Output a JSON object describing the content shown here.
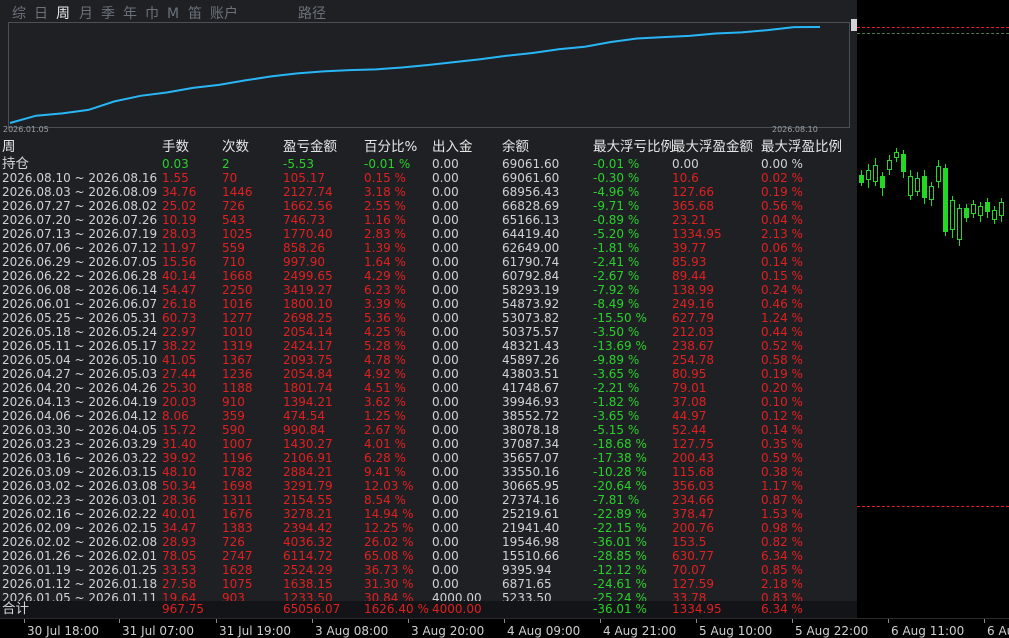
{
  "tabs": [
    {
      "label": "综",
      "active": false
    },
    {
      "label": "日",
      "active": false
    },
    {
      "label": "周",
      "active": true
    },
    {
      "label": "月",
      "active": false
    },
    {
      "label": "季",
      "active": false
    },
    {
      "label": "年",
      "active": false
    },
    {
      "label": "巾",
      "active": false
    },
    {
      "label": "M",
      "active": false
    },
    {
      "label": "笛",
      "active": false
    },
    {
      "label": "账户",
      "active": false
    },
    {
      "label": "路径",
      "active": false
    }
  ],
  "equity_curve": {
    "start_date": "2026.01.05",
    "end_date": "2026.08.10",
    "line_color": "#29b6f6"
  },
  "table": {
    "headers": [
      "周",
      "手数",
      "次数",
      "盈亏金额",
      "百分比%",
      "出入金",
      "余额",
      "最大浮亏比例",
      "最大浮盈金额",
      "最大浮盈比例"
    ],
    "holding": {
      "label": "持仓",
      "lots": "0.03",
      "count": "2",
      "pnl": "-5.53",
      "pct": "-0.01 %",
      "flow": "0.00",
      "balance": "69061.60",
      "max_dd_pct": "-0.01 %",
      "max_fp_amt": "0.00",
      "max_fp_pct": "0.00 %"
    },
    "rows": [
      [
        "2026.08.10 ~ 2026.08.16",
        "1.55",
        "70",
        "105.17",
        "0.15 %",
        "0.00",
        "69061.60",
        "-0.30 %",
        "10.6",
        "0.02 %"
      ],
      [
        "2026.08.03 ~ 2026.08.09",
        "34.76",
        "1446",
        "2127.74",
        "3.18 %",
        "0.00",
        "68956.43",
        "-4.96 %",
        "127.66",
        "0.19 %"
      ],
      [
        "2026.07.27 ~ 2026.08.02",
        "25.02",
        "726",
        "1662.56",
        "2.55 %",
        "0.00",
        "66828.69",
        "-9.71 %",
        "365.68",
        "0.56 %"
      ],
      [
        "2026.07.20 ~ 2026.07.26",
        "10.19",
        "543",
        "746.73",
        "1.16 %",
        "0.00",
        "65166.13",
        "-0.89 %",
        "23.21",
        "0.04 %"
      ],
      [
        "2026.07.13 ~ 2026.07.19",
        "28.03",
        "1025",
        "1770.40",
        "2.83 %",
        "0.00",
        "64419.40",
        "-5.20 %",
        "1334.95",
        "2.13 %"
      ],
      [
        "2026.07.06 ~ 2026.07.12",
        "11.97",
        "559",
        "858.26",
        "1.39 %",
        "0.00",
        "62649.00",
        "-1.81 %",
        "39.77",
        "0.06 %"
      ],
      [
        "2026.06.29 ~ 2026.07.05",
        "15.56",
        "710",
        "997.90",
        "1.64 %",
        "0.00",
        "61790.74",
        "-2.41 %",
        "85.93",
        "0.14 %"
      ],
      [
        "2026.06.22 ~ 2026.06.28",
        "40.14",
        "1668",
        "2499.65",
        "4.29 %",
        "0.00",
        "60792.84",
        "-2.67 %",
        "89.44",
        "0.15 %"
      ],
      [
        "2026.06.08 ~ 2026.06.14",
        "54.47",
        "2250",
        "3419.27",
        "6.23 %",
        "0.00",
        "58293.19",
        "-7.92 %",
        "138.99",
        "0.24 %"
      ],
      [
        "2026.06.01 ~ 2026.06.07",
        "26.18",
        "1016",
        "1800.10",
        "3.39 %",
        "0.00",
        "54873.92",
        "-8.49 %",
        "249.16",
        "0.46 %"
      ],
      [
        "2026.05.25 ~ 2026.05.31",
        "60.73",
        "1277",
        "2698.25",
        "5.36 %",
        "0.00",
        "53073.82",
        "-15.50 %",
        "627.79",
        "1.24 %"
      ],
      [
        "2026.05.18 ~ 2026.05.24",
        "22.97",
        "1010",
        "2054.14",
        "4.25 %",
        "0.00",
        "50375.57",
        "-3.50 %",
        "212.03",
        "0.44 %"
      ],
      [
        "2026.05.11 ~ 2026.05.17",
        "38.22",
        "1319",
        "2424.17",
        "5.28 %",
        "0.00",
        "48321.43",
        "-13.69 %",
        "238.67",
        "0.52 %"
      ],
      [
        "2026.05.04 ~ 2026.05.10",
        "41.05",
        "1367",
        "2093.75",
        "4.78 %",
        "0.00",
        "45897.26",
        "-9.89 %",
        "254.78",
        "0.58 %"
      ],
      [
        "2026.04.27 ~ 2026.05.03",
        "27.44",
        "1236",
        "2054.84",
        "4.92 %",
        "0.00",
        "43803.51",
        "-3.65 %",
        "80.95",
        "0.19 %"
      ],
      [
        "2026.04.20 ~ 2026.04.26",
        "25.30",
        "1188",
        "1801.74",
        "4.51 %",
        "0.00",
        "41748.67",
        "-2.21 %",
        "79.01",
        "0.20 %"
      ],
      [
        "2026.04.13 ~ 2026.04.19",
        "20.03",
        "910",
        "1394.21",
        "3.62 %",
        "0.00",
        "39946.93",
        "-1.82 %",
        "37.08",
        "0.10 %"
      ],
      [
        "2026.04.06 ~ 2026.04.12",
        "8.06",
        "359",
        "474.54",
        "1.25 %",
        "0.00",
        "38552.72",
        "-3.65 %",
        "44.97",
        "0.12 %"
      ],
      [
        "2026.03.30 ~ 2026.04.05",
        "15.72",
        "590",
        "990.84",
        "2.67 %",
        "0.00",
        "38078.18",
        "-5.15 %",
        "52.44",
        "0.14 %"
      ],
      [
        "2026.03.23 ~ 2026.03.29",
        "31.40",
        "1007",
        "1430.27",
        "4.01 %",
        "0.00",
        "37087.34",
        "-18.68 %",
        "127.75",
        "0.35 %"
      ],
      [
        "2026.03.16 ~ 2026.03.22",
        "39.92",
        "1196",
        "2106.91",
        "6.28 %",
        "0.00",
        "35657.07",
        "-17.38 %",
        "200.43",
        "0.59 %"
      ],
      [
        "2026.03.09 ~ 2026.03.15",
        "48.10",
        "1782",
        "2884.21",
        "9.41 %",
        "0.00",
        "33550.16",
        "-10.28 %",
        "115.68",
        "0.38 %"
      ],
      [
        "2026.03.02 ~ 2026.03.08",
        "50.34",
        "1698",
        "3291.79",
        "12.03 %",
        "0.00",
        "30665.95",
        "-20.64 %",
        "356.03",
        "1.17 %"
      ],
      [
        "2026.02.23 ~ 2026.03.01",
        "28.36",
        "1311",
        "2154.55",
        "8.54 %",
        "0.00",
        "27374.16",
        "-7.81 %",
        "234.66",
        "0.87 %"
      ],
      [
        "2026.02.16 ~ 2026.02.22",
        "40.01",
        "1676",
        "3278.21",
        "14.94 %",
        "0.00",
        "25219.61",
        "-22.89 %",
        "378.47",
        "1.53 %"
      ],
      [
        "2026.02.09 ~ 2026.02.15",
        "34.47",
        "1383",
        "2394.42",
        "12.25 %",
        "0.00",
        "21941.40",
        "-22.15 %",
        "200.76",
        "0.98 %"
      ],
      [
        "2026.02.02 ~ 2026.02.08",
        "28.93",
        "726",
        "4036.32",
        "26.02 %",
        "0.00",
        "19546.98",
        "-36.01 %",
        "153.5",
        "0.82 %"
      ],
      [
        "2026.01.26 ~ 2026.02.01",
        "78.05",
        "2747",
        "6114.72",
        "65.08 %",
        "0.00",
        "15510.66",
        "-28.85 %",
        "630.77",
        "6.34 %"
      ],
      [
        "2026.01.19 ~ 2026.01.25",
        "33.53",
        "1628",
        "2524.29",
        "36.73 %",
        "0.00",
        "9395.94",
        "-12.12 %",
        "70.07",
        "0.85 %"
      ],
      [
        "2026.01.12 ~ 2026.01.18",
        "27.58",
        "1075",
        "1638.15",
        "31.30 %",
        "0.00",
        "6871.65",
        "-24.61 %",
        "127.59",
        "2.18 %"
      ],
      [
        "2026.01.05 ~ 2026.01.11",
        "19.64",
        "903",
        "1233.50",
        "30.84 %",
        "4000.00",
        "5233.50",
        "-25.24 %",
        "33.78",
        "0.83 %"
      ]
    ],
    "total": {
      "label": "合计",
      "lots": "967.75",
      "count": "",
      "pnl": "65056.07",
      "pct": "1626.40 %",
      "flow": "4000.00",
      "balance": "",
      "max_dd_pct": "-36.01 %",
      "max_fp_amt": "1334.95",
      "max_fp_pct": "6.34 %"
    }
  },
  "time_axis": [
    "30 Jul 18:00",
    "31 Jul 07:00",
    "31 Jul 19:00",
    "3 Aug 08:00",
    "3 Aug 20:00",
    "4 Aug 09:00",
    "4 Aug 21:00",
    "5 Aug 10:00",
    "5 Aug 22:00",
    "6 Aug 11:00",
    "6 Au"
  ],
  "colors": {
    "panel_bg": "#1e2024",
    "positive": "#e02020",
    "negative": "#2ad12a",
    "text": "#d2d2d2",
    "curve": "#29b6f6",
    "candle": "#22d822"
  }
}
